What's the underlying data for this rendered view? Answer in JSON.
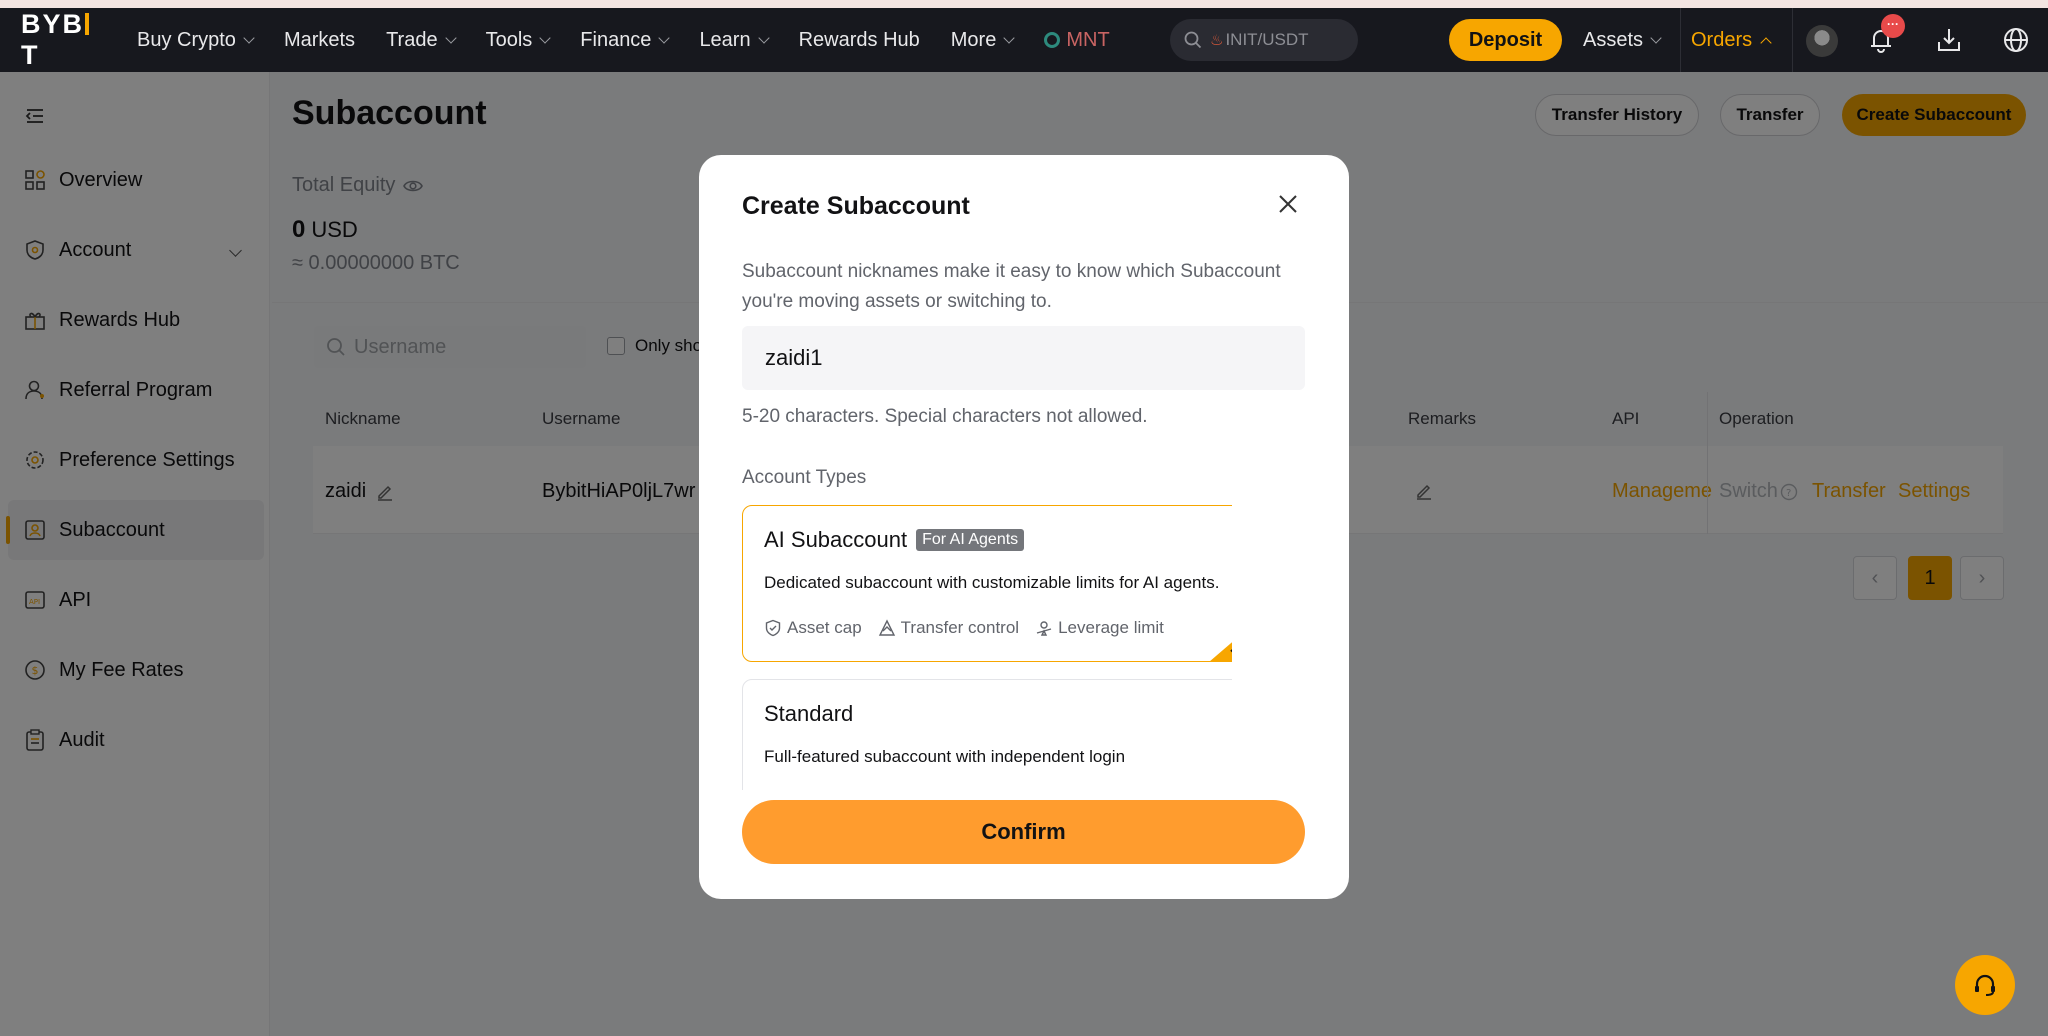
{
  "brand": {
    "logo": "BYBIT"
  },
  "nav": {
    "items": [
      {
        "label": "Buy Crypto",
        "dropdown": true
      },
      {
        "label": "Markets",
        "dropdown": false
      },
      {
        "label": "Trade",
        "dropdown": true
      },
      {
        "label": "Tools",
        "dropdown": true
      },
      {
        "label": "Finance",
        "dropdown": true
      },
      {
        "label": "Learn",
        "dropdown": true
      },
      {
        "label": "Rewards Hub",
        "dropdown": false
      },
      {
        "label": "More",
        "dropdown": true
      }
    ],
    "promo": "MNT",
    "search_placeholder": "INIT/USDT",
    "deposit": "Deposit",
    "assets": "Assets",
    "orders": "Orders",
    "notification_badge": "···"
  },
  "sidebar": {
    "items": [
      {
        "label": "Overview",
        "icon": "grid-icon"
      },
      {
        "label": "Account",
        "icon": "shield-icon",
        "expandable": true
      },
      {
        "label": "Rewards Hub",
        "icon": "gift-icon"
      },
      {
        "label": "Referral Program",
        "icon": "person-icon"
      },
      {
        "label": "Preference Settings",
        "icon": "gear-icon"
      },
      {
        "label": "Subaccount",
        "icon": "subaccount-icon",
        "active": true
      },
      {
        "label": "API",
        "icon": "api-icon"
      },
      {
        "label": "My Fee Rates",
        "icon": "coin-icon"
      },
      {
        "label": "Audit",
        "icon": "clipboard-icon"
      }
    ]
  },
  "main": {
    "title": "Subaccount",
    "buttons": {
      "transfer_history": "Transfer History",
      "transfer": "Transfer",
      "create": "Create Subaccount"
    },
    "equity": {
      "label": "Total Equity",
      "value": "0",
      "unit": "USD",
      "btc": "≈ 0.00000000 BTC"
    },
    "filter": {
      "search_placeholder": "Username",
      "only_show": "Only sho"
    },
    "table": {
      "headers": {
        "nickname": "Nickname",
        "username": "Username",
        "remarks": "Remarks",
        "api": "API",
        "operation": "Operation"
      },
      "row": {
        "nickname": "zaidi",
        "username": "BybitHiAP0ljL7wr",
        "api": "Manageme",
        "switch": "Switch",
        "transfer": "Transfer",
        "settings": "Settings"
      }
    },
    "pagination": {
      "prev": "‹",
      "current": "1",
      "next": "›"
    }
  },
  "modal": {
    "title": "Create Subaccount",
    "description": "Subaccount nicknames make it easy to know which Subaccount you're moving assets or switching to.",
    "nickname_value": "zaidi1",
    "hint": "5-20 characters. Special characters not allowed.",
    "account_types_label": "Account Types",
    "types": [
      {
        "title": "AI Subaccount",
        "tag": "For AI Agents",
        "description": "Dedicated subaccount with customizable limits for AI agents.",
        "features": [
          "Asset cap",
          "Transfer control",
          "Leverage limit"
        ],
        "selected": true
      },
      {
        "title": "Standard",
        "description": "Full-featured subaccount with independent login",
        "selected": false
      }
    ],
    "confirm": "Confirm"
  },
  "colors": {
    "accent": "#f7a600",
    "confirm": "#ff9c2e",
    "topbar": "#17181e"
  }
}
